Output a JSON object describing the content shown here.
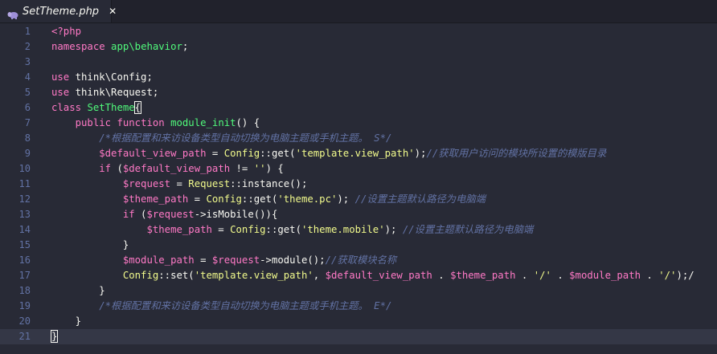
{
  "tab": {
    "title": "SetTheme.php",
    "close": "✕",
    "icon": "php-elephant-icon"
  },
  "colors": {
    "background": "#282a36",
    "keyword": "#ff79c6",
    "function": "#50fa7b",
    "class": "#8be9fd",
    "string": "#f1fa8c",
    "comment": "#6272a4"
  },
  "lines": [
    {
      "num": "1",
      "tokens": [
        [
          "tag",
          "<?php"
        ]
      ]
    },
    {
      "num": "2",
      "tokens": [
        [
          "kw",
          "namespace"
        ],
        [
          "txt",
          " "
        ],
        [
          "fn",
          "app\\behavior"
        ],
        [
          "txt",
          ";"
        ]
      ]
    },
    {
      "num": "3",
      "tokens": []
    },
    {
      "num": "4",
      "tokens": [
        [
          "kw",
          "use"
        ],
        [
          "txt",
          " think\\Config;"
        ]
      ]
    },
    {
      "num": "5",
      "tokens": [
        [
          "kw",
          "use"
        ],
        [
          "txt",
          " think\\Request;"
        ]
      ]
    },
    {
      "num": "6",
      "tokens": [
        [
          "kw",
          "class"
        ],
        [
          "txt",
          " "
        ],
        [
          "fn",
          "SetTheme"
        ],
        [
          "brk",
          "{"
        ]
      ]
    },
    {
      "num": "7",
      "tokens": [
        [
          "txt",
          "    "
        ],
        [
          "kw",
          "public"
        ],
        [
          "txt",
          " "
        ],
        [
          "kw",
          "function"
        ],
        [
          "txt",
          " "
        ],
        [
          "fn",
          "module_init"
        ],
        [
          "txt",
          "() {"
        ]
      ]
    },
    {
      "num": "8",
      "tokens": [
        [
          "txt",
          "        "
        ],
        [
          "com",
          "/*根据配置和来访设备类型自动切换为电脑主题或手机主题。 S*/"
        ]
      ]
    },
    {
      "num": "9",
      "tokens": [
        [
          "txt",
          "        "
        ],
        [
          "var",
          "$default_view_path"
        ],
        [
          "txt",
          " = "
        ],
        [
          "str",
          "Config"
        ],
        [
          "txt",
          "::get("
        ],
        [
          "str",
          "'template.view_path'"
        ],
        [
          "txt",
          ");"
        ],
        [
          "com",
          "//获取用户访问的模块所设置的模版目录"
        ]
      ]
    },
    {
      "num": "10",
      "tokens": [
        [
          "txt",
          "        "
        ],
        [
          "kw",
          "if"
        ],
        [
          "txt",
          " ("
        ],
        [
          "var",
          "$default_view_path"
        ],
        [
          "txt",
          " != "
        ],
        [
          "str",
          "''"
        ],
        [
          "txt",
          ") {"
        ]
      ]
    },
    {
      "num": "11",
      "tokens": [
        [
          "txt",
          "            "
        ],
        [
          "var",
          "$request"
        ],
        [
          "txt",
          " = "
        ],
        [
          "str",
          "Request"
        ],
        [
          "txt",
          "::instance();"
        ]
      ]
    },
    {
      "num": "12",
      "tokens": [
        [
          "txt",
          "            "
        ],
        [
          "var",
          "$theme_path"
        ],
        [
          "txt",
          " = "
        ],
        [
          "str",
          "Config"
        ],
        [
          "txt",
          "::get("
        ],
        [
          "str",
          "'theme.pc'"
        ],
        [
          "txt",
          "); "
        ],
        [
          "com",
          "//设置主题默认路径为电脑端"
        ]
      ]
    },
    {
      "num": "13",
      "tokens": [
        [
          "txt",
          "            "
        ],
        [
          "kw",
          "if"
        ],
        [
          "txt",
          " ("
        ],
        [
          "var",
          "$request"
        ],
        [
          "txt",
          "->isMobile()){"
        ]
      ]
    },
    {
      "num": "14",
      "tokens": [
        [
          "txt",
          "                "
        ],
        [
          "var",
          "$theme_path"
        ],
        [
          "txt",
          " = "
        ],
        [
          "str",
          "Config"
        ],
        [
          "txt",
          "::get("
        ],
        [
          "str",
          "'theme.mobile'"
        ],
        [
          "txt",
          "); "
        ],
        [
          "com",
          "//设置主题默认路径为电脑端"
        ]
      ]
    },
    {
      "num": "15",
      "tokens": [
        [
          "txt",
          "            }"
        ]
      ]
    },
    {
      "num": "16",
      "tokens": [
        [
          "txt",
          "            "
        ],
        [
          "var",
          "$module_path"
        ],
        [
          "txt",
          " = "
        ],
        [
          "var",
          "$request"
        ],
        [
          "txt",
          "->module();"
        ],
        [
          "com",
          "//获取模块名称"
        ]
      ]
    },
    {
      "num": "17",
      "tokens": [
        [
          "txt",
          "            "
        ],
        [
          "str",
          "Config"
        ],
        [
          "txt",
          "::set("
        ],
        [
          "str",
          "'template.view_path'"
        ],
        [
          "txt",
          ", "
        ],
        [
          "var",
          "$default_view_path"
        ],
        [
          "txt",
          " . "
        ],
        [
          "var",
          "$theme_path"
        ],
        [
          "txt",
          " . "
        ],
        [
          "str",
          "'/'"
        ],
        [
          "txt",
          " . "
        ],
        [
          "var",
          "$module_path"
        ],
        [
          "txt",
          " . "
        ],
        [
          "str",
          "'/'"
        ],
        [
          "txt",
          ");/"
        ]
      ]
    },
    {
      "num": "18",
      "tokens": [
        [
          "txt",
          "        }"
        ]
      ]
    },
    {
      "num": "19",
      "tokens": [
        [
          "txt",
          "        "
        ],
        [
          "com",
          "/*根据配置和来访设备类型自动切换为电脑主题或手机主题。 E*/"
        ]
      ]
    },
    {
      "num": "20",
      "tokens": [
        [
          "txt",
          "    }"
        ]
      ]
    },
    {
      "num": "21",
      "tokens": [
        [
          "brk",
          "}"
        ]
      ],
      "active": true
    }
  ]
}
